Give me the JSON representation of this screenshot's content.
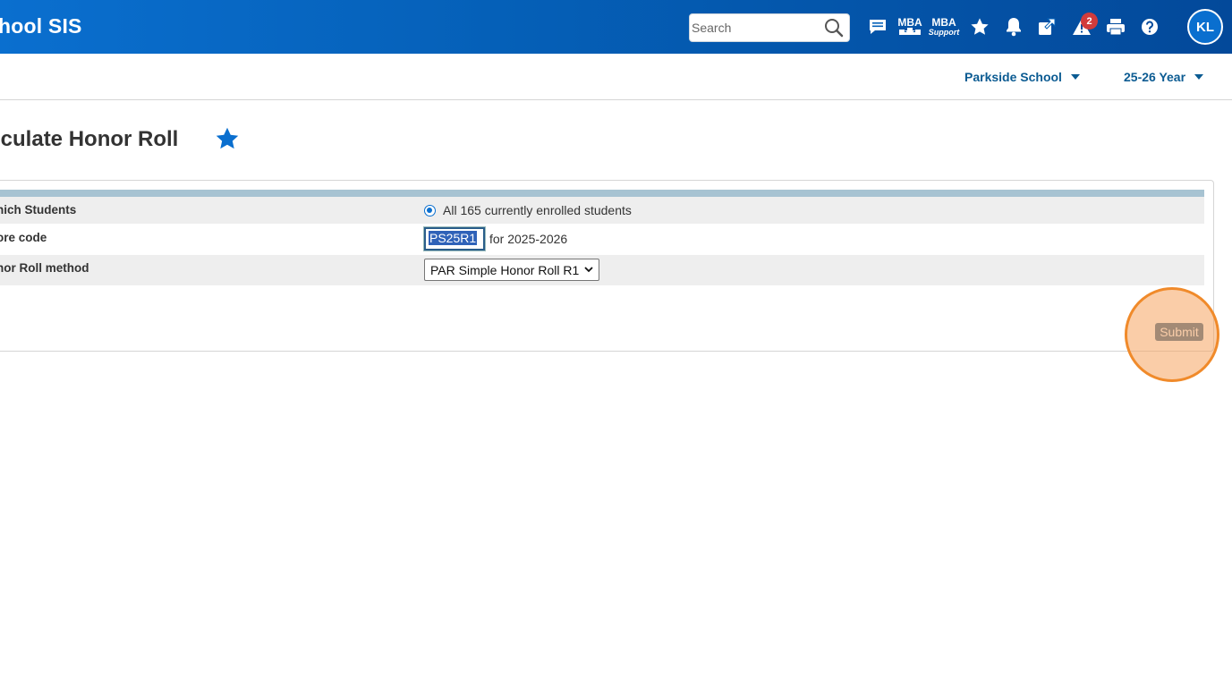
{
  "header": {
    "brand": "hool SIS",
    "search_placeholder": "Search",
    "mba_label": "MBA",
    "mba_support_label": "MBA",
    "mba_support_sub": "Support",
    "alerts_count": "2",
    "avatar_initials": "KL",
    "icons": [
      "search-icon",
      "messages-icon",
      "mba-icon",
      "mba-support-icon",
      "favorites-star-icon",
      "notifications-bell-icon",
      "external-link-icon",
      "alert-triangle-icon",
      "printer-icon",
      "help-icon"
    ]
  },
  "subheader": {
    "school": "Parkside School",
    "term": "25-26 Year"
  },
  "page": {
    "title": "lculate Honor Roll"
  },
  "form": {
    "rows": [
      {
        "label": "hich Students",
        "value": "All 165 currently enrolled students"
      },
      {
        "label": "ore code",
        "input_value": "PS25R1",
        "suffix": "for 2025-2026"
      },
      {
        "label": "nor Roll method",
        "selected": "PAR Simple Honor Roll R1"
      }
    ],
    "submit_label": "Submit"
  },
  "colors": {
    "header_start": "#0a6fcf",
    "header_end": "#03499a",
    "link_blue": "#0b5b92",
    "star_blue": "#0a6fcf",
    "highlight_orange": "#f08a2a",
    "badge_red": "#d23b3b"
  }
}
